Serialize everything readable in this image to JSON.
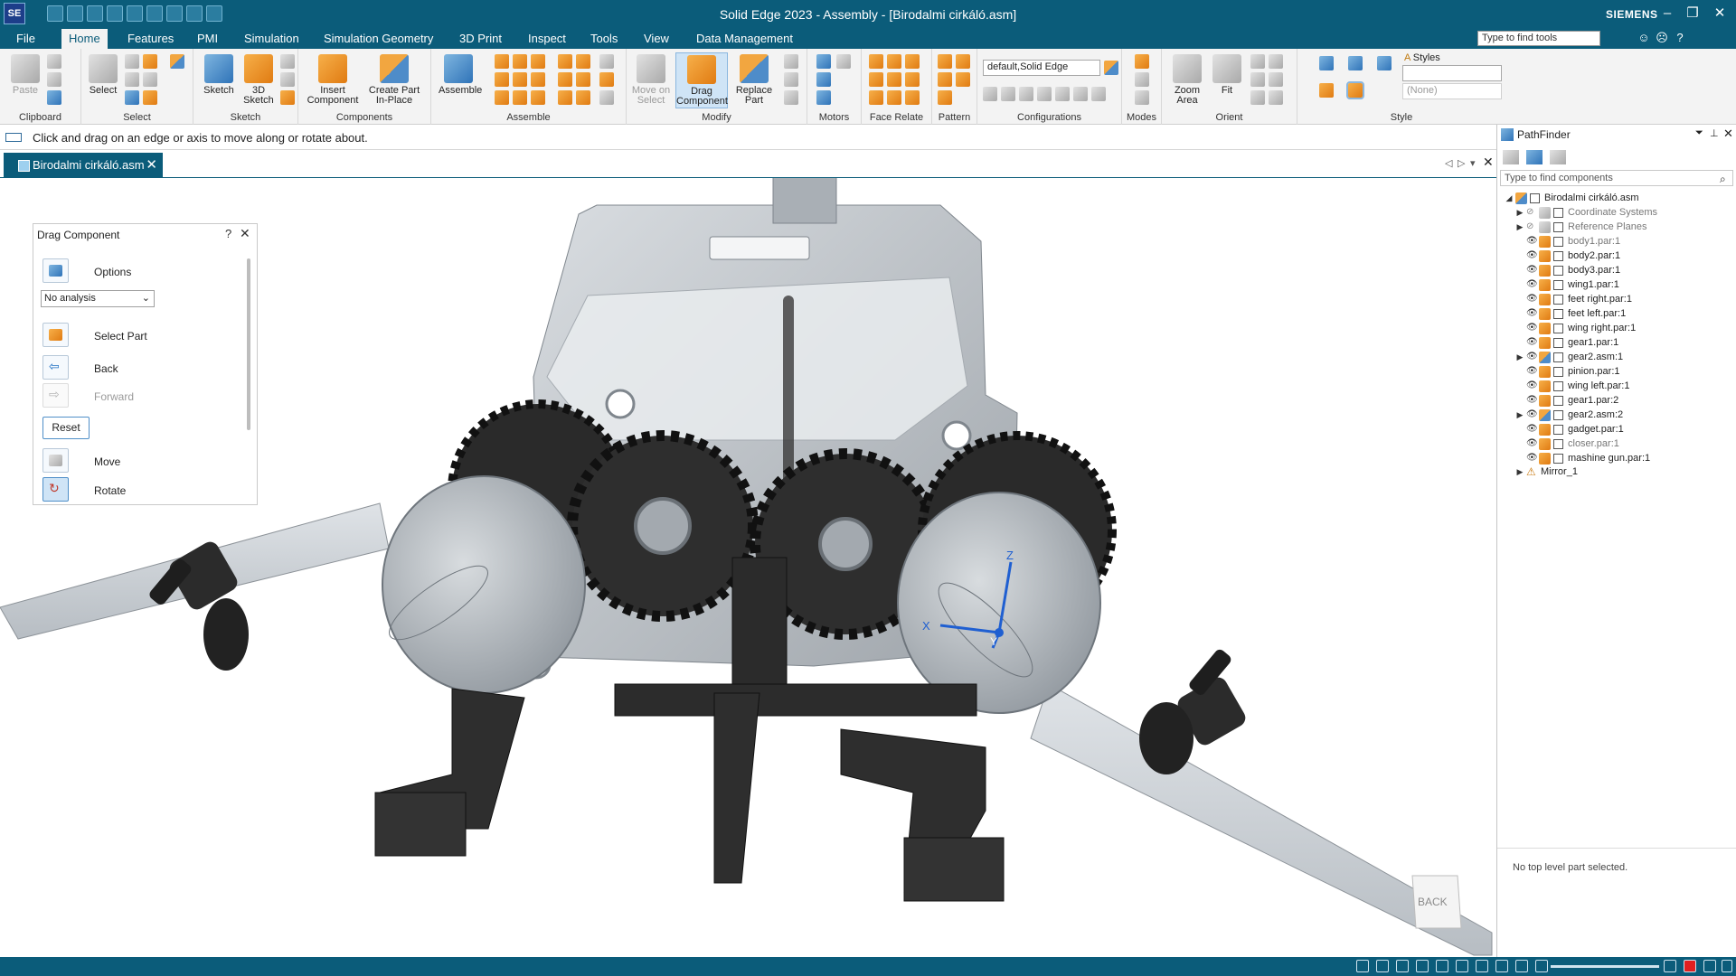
{
  "app": {
    "title": "Solid Edge 2023 - Assembly - [Birodalmi cirkáló.asm]",
    "logo_text": "SE",
    "brand": "SIEMENS"
  },
  "window_controls": {
    "minimize": "–",
    "restore": "❐",
    "close": "✕"
  },
  "menu": {
    "tabs": [
      "File",
      "Home",
      "Features",
      "PMI",
      "Simulation",
      "Simulation Geometry",
      "3D Print",
      "Inspect",
      "Tools",
      "View",
      "Data Management"
    ],
    "active": "Home",
    "search_placeholder": "Type to find tools"
  },
  "ribbon": {
    "groups": {
      "clipboard": "Clipboard",
      "select": "Select",
      "sketch": "Sketch",
      "components": "Components",
      "assemble": "Assemble",
      "modify": "Modify",
      "motors": "Motors",
      "face_relate": "Face Relate",
      "pattern": "Pattern",
      "configurations": "Configurations",
      "modes": "Modes",
      "orient": "Orient",
      "style": "Style"
    },
    "buttons": {
      "paste": "Paste",
      "select": "Select",
      "sketch": "Sketch",
      "sketch3d_1": "3D",
      "sketch3d_2": "Sketch",
      "insert_1": "Insert",
      "insert_2": "Component",
      "createpart_1": "Create Part",
      "createpart_2": "In-Place",
      "assemble": "Assemble",
      "moveonselect_1": "Move on",
      "moveonselect_2": "Select",
      "drag_1": "Drag",
      "drag_2": "Component",
      "replace_1": "Replace",
      "replace_2": "Part",
      "zoomarea_1": "Zoom",
      "zoomarea_2": "Area",
      "fit": "Fit"
    },
    "config_combo": "default,Solid Edge",
    "styles_label": "Styles",
    "style_none": "(None)"
  },
  "prompt": "Click and drag on an edge or axis to move along or rotate about.",
  "document_tab": "Birodalmi cirkáló.asm",
  "drag_panel": {
    "title": "Drag Component",
    "help": "?",
    "options": "Options",
    "analysis": "No analysis",
    "select_part": "Select Part",
    "back": "Back",
    "forward": "Forward",
    "reset": "Reset",
    "move": "Move",
    "rotate": "Rotate"
  },
  "pathfinder": {
    "title": "PathFinder",
    "search_placeholder": "Type to find components",
    "root": "Birodalmi cirkáló.asm",
    "items": [
      {
        "label": "Coordinate Systems",
        "expand": true,
        "dim": true,
        "type": "csys"
      },
      {
        "label": "Reference Planes",
        "expand": true,
        "dim": true,
        "type": "planes"
      },
      {
        "label": "body1.par:1",
        "type": "part",
        "dim": true
      },
      {
        "label": "body2.par:1",
        "type": "part"
      },
      {
        "label": "body3.par:1",
        "type": "part"
      },
      {
        "label": "wing1.par:1",
        "type": "part"
      },
      {
        "label": "feet right.par:1",
        "type": "part"
      },
      {
        "label": "feet left.par:1",
        "type": "part"
      },
      {
        "label": "wing right.par:1",
        "type": "part"
      },
      {
        "label": "gear1.par:1",
        "type": "part"
      },
      {
        "label": "gear2.asm:1",
        "type": "asm",
        "expand": true
      },
      {
        "label": "pinion.par:1",
        "type": "part"
      },
      {
        "label": "wing left.par:1",
        "type": "part"
      },
      {
        "label": "gear1.par:2",
        "type": "part"
      },
      {
        "label": "gear2.asm:2",
        "type": "asm",
        "expand": true
      },
      {
        "label": "gadget.par:1",
        "type": "part"
      },
      {
        "label": "closer.par:1",
        "type": "part",
        "dim": true
      },
      {
        "label": "mashine gun.par:1",
        "type": "part"
      }
    ],
    "mirror": "Mirror_1",
    "status": "No top level part selected."
  },
  "viewport": {
    "axes": {
      "x": "X",
      "y": "Y",
      "z": "Z"
    },
    "view_cube": "BACK"
  },
  "colors": {
    "accent": "#0b5c7a",
    "part_orange": "#e88a1a",
    "model_grey": "#b9bec4",
    "model_dark": "#2b2b2b"
  }
}
